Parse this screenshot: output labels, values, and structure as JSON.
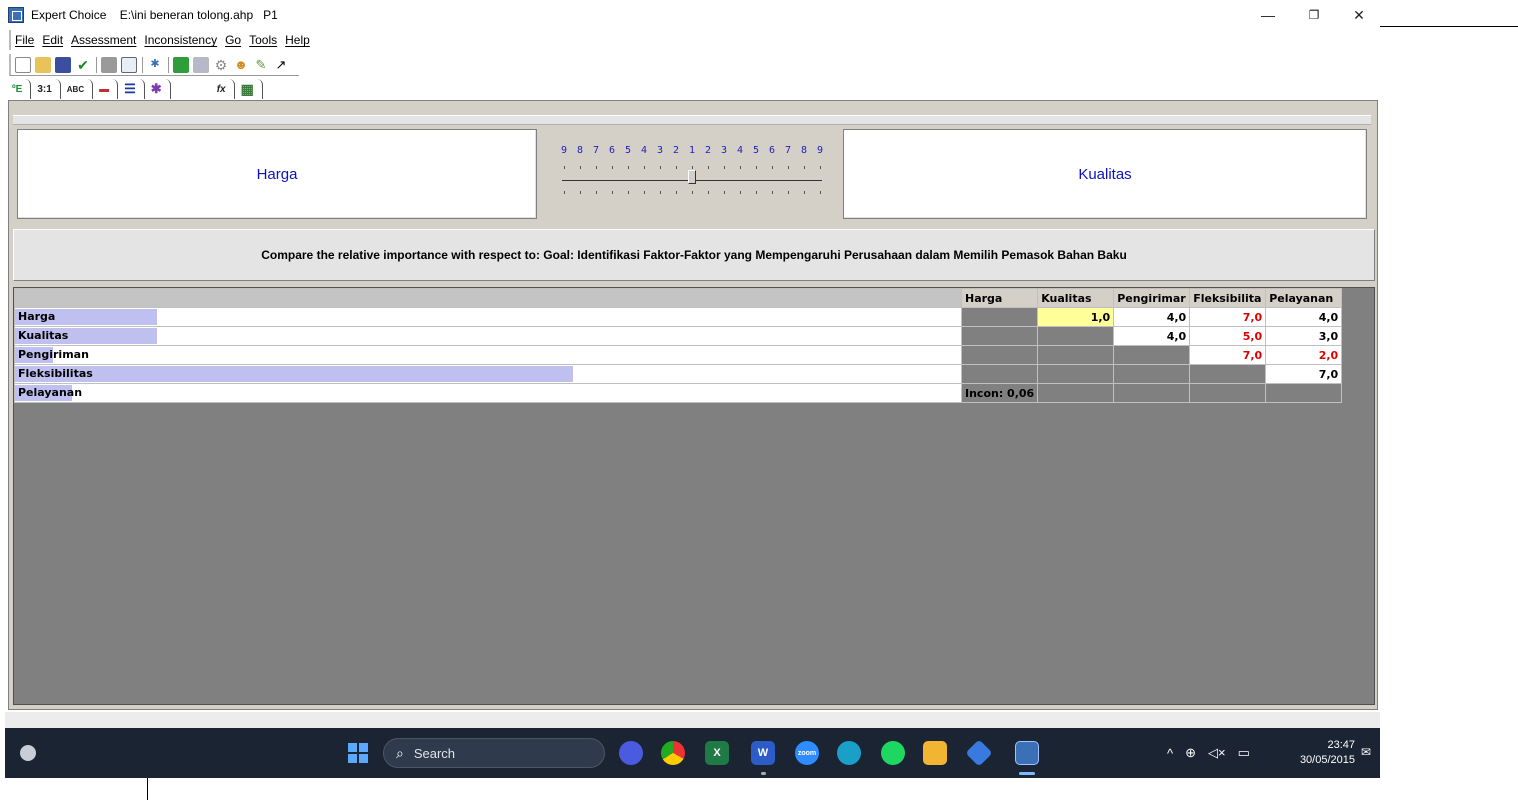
{
  "window": {
    "title": "Expert Choice    E:\\ini beneran tolong.ahp   P1",
    "minimize": "—",
    "restore": "❐",
    "close": "✕"
  },
  "menu": [
    "File",
    "Edit",
    "Assessment",
    "Inconsistency",
    "Go",
    "Tools",
    "Help"
  ],
  "toolbar_icons": [
    "new-file-icon",
    "open-folder-icon",
    "save-icon",
    "check-icon",
    "print-icon",
    "print-preview-icon",
    "model-icon",
    "calculator-icon",
    "chart-icon",
    "sensitivity-icon",
    "users-icon",
    "wand-icon",
    "goal-arrow-icon"
  ],
  "tabs": [
    {
      "icon": "tree-icon",
      "label": "ºE"
    },
    {
      "icon": "numerical-icon",
      "label": "3:1"
    },
    {
      "icon": "verbal-icon",
      "label": "ABC"
    },
    {
      "icon": "graphical-icon",
      "label": "▬"
    },
    {
      "icon": "bars-icon",
      "label": "☰"
    },
    {
      "icon": "questionnaire-icon",
      "label": "✱"
    },
    {
      "icon": "formula-icon",
      "label": "fx"
    },
    {
      "icon": "grid-icon",
      "label": "▦"
    }
  ],
  "comparison": {
    "left_element": "Harga",
    "right_element": "Kualitas",
    "scale_labels": [
      "9",
      "8",
      "7",
      "6",
      "5",
      "4",
      "3",
      "2",
      "1",
      "2",
      "3",
      "4",
      "5",
      "6",
      "7",
      "8",
      "9"
    ],
    "scale_value": 0.5,
    "prompt": "Compare the relative importance with respect to: Goal: Identifikasi Faktor-Faktor yang Mempengaruhi Perusahaan dalam Memilih Pemasok Bahan Baku"
  },
  "matrix": {
    "columns": [
      "Harga",
      "Kualitas",
      "Pengirimar",
      "Fleksibilita",
      "Pelayanan"
    ],
    "rows": [
      {
        "label": "Harga",
        "bar": 0.15,
        "cells": [
          {
            "v": "",
            "t": "grey"
          },
          {
            "v": "1,0",
            "t": "yellow"
          },
          {
            "v": "4,0",
            "t": "black"
          },
          {
            "v": "7,0",
            "t": "red"
          },
          {
            "v": "4,0",
            "t": "black"
          }
        ]
      },
      {
        "label": "Kualitas",
        "bar": 0.15,
        "cells": [
          {
            "v": "",
            "t": "grey"
          },
          {
            "v": "",
            "t": "grey"
          },
          {
            "v": "4,0",
            "t": "black"
          },
          {
            "v": "5,0",
            "t": "red"
          },
          {
            "v": "3,0",
            "t": "black"
          }
        ]
      },
      {
        "label": "Pengiriman",
        "bar": 0.04,
        "cells": [
          {
            "v": "",
            "t": "grey"
          },
          {
            "v": "",
            "t": "grey"
          },
          {
            "v": "",
            "t": "grey"
          },
          {
            "v": "7,0",
            "t": "red"
          },
          {
            "v": "2,0",
            "t": "red"
          }
        ]
      },
      {
        "label": "Fleksibilitas",
        "bar": 0.59,
        "cells": [
          {
            "v": "",
            "t": "grey"
          },
          {
            "v": "",
            "t": "grey"
          },
          {
            "v": "",
            "t": "grey"
          },
          {
            "v": "",
            "t": "grey"
          },
          {
            "v": "7,0",
            "t": "black"
          }
        ]
      },
      {
        "label": "Pelayanan",
        "bar": 0.06,
        "cells": [
          {
            "v": "Incon: 0,06",
            "t": "incon"
          },
          {
            "v": "",
            "t": "grey"
          },
          {
            "v": "",
            "t": "grey"
          },
          {
            "v": "",
            "t": "grey"
          },
          {
            "v": "",
            "t": "grey"
          }
        ]
      }
    ]
  },
  "taskbar": {
    "search_placeholder": "Search",
    "apps": [
      "camera-app-icon",
      "chrome-icon",
      "excel-icon",
      "word-icon",
      "zoom-icon",
      "edge-icon",
      "spotify-icon",
      "file-explorer-icon",
      "copilot-icon",
      "expert-choice-icon"
    ],
    "app_labels": {
      "word": "W",
      "zoom": "zoom",
      "excel": "X"
    },
    "tray": {
      "chevron": "^",
      "network": "⊕",
      "volume": "◁×",
      "battery": "▭"
    },
    "time": "23:47",
    "date": "30/05/2015",
    "notification": "✉"
  }
}
